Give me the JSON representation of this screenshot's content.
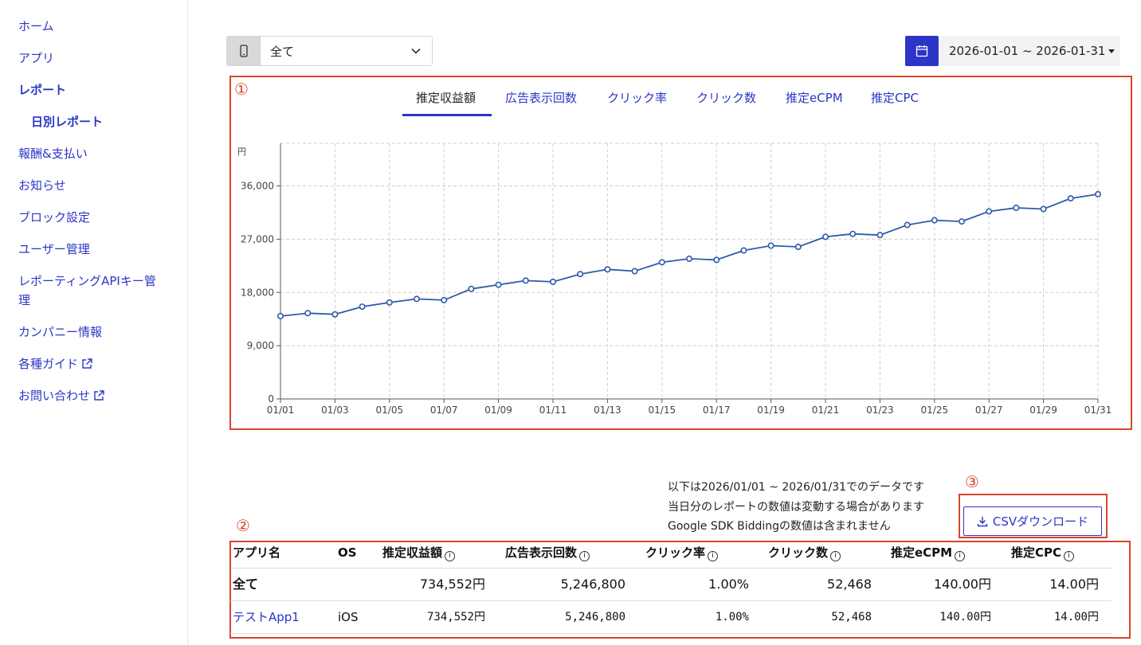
{
  "sidebar": {
    "items": [
      {
        "label": "ホーム"
      },
      {
        "label": "アプリ"
      },
      {
        "label": "レポート"
      },
      {
        "label": "日別レポート"
      },
      {
        "label": "報酬&支払い"
      },
      {
        "label": "お知らせ"
      },
      {
        "label": "ブロック設定"
      },
      {
        "label": "ユーザー管理"
      },
      {
        "label": "レポーティングAPIキー管"
      },
      {
        "label": "理"
      },
      {
        "label": "カンパニー情報"
      },
      {
        "label": "各種ガイド"
      },
      {
        "label": "お問い合わせ"
      }
    ]
  },
  "filters": {
    "app_select_value": "全て",
    "date_range": "2026-01-01 ~ 2026-01-31"
  },
  "annotations": [
    "①",
    "②",
    "③"
  ],
  "tabs": [
    {
      "label": "推定収益額",
      "active": true
    },
    {
      "label": "広告表示回数"
    },
    {
      "label": "クリック率"
    },
    {
      "label": "クリック数"
    },
    {
      "label": "推定eCPM"
    },
    {
      "label": "推定CPC"
    }
  ],
  "chart_data": {
    "type": "line",
    "ylabel": "円",
    "ylim": [
      0,
      43200
    ],
    "yticks": [
      0,
      9000,
      18000,
      27000,
      36000
    ],
    "ytick_labels": [
      "0",
      "9,000",
      "18,000",
      "27,000",
      "36,000"
    ],
    "x": [
      "01/01",
      "01/02",
      "01/03",
      "01/04",
      "01/05",
      "01/06",
      "01/07",
      "01/08",
      "01/09",
      "01/10",
      "01/11",
      "01/12",
      "01/13",
      "01/14",
      "01/15",
      "01/16",
      "01/17",
      "01/18",
      "01/19",
      "01/20",
      "01/21",
      "01/22",
      "01/23",
      "01/24",
      "01/25",
      "01/26",
      "01/27",
      "01/28",
      "01/29",
      "01/30",
      "01/31"
    ],
    "xtick_labels": [
      "01/01",
      "01/03",
      "01/05",
      "01/07",
      "01/09",
      "01/11",
      "01/13",
      "01/15",
      "01/17",
      "01/19",
      "01/21",
      "01/23",
      "01/25",
      "01/27",
      "01/29",
      "01/31"
    ],
    "series": [
      {
        "values": [
          14000,
          14500,
          14300,
          15600,
          16300,
          16900,
          16700,
          18600,
          19300,
          20000,
          19800,
          21100,
          21900,
          21600,
          23100,
          23700,
          23500,
          25100,
          25900,
          25700,
          27400,
          27900,
          27700,
          29400,
          30200,
          30000,
          31700,
          32300,
          32100,
          33900,
          34600
        ]
      }
    ],
    "grid": true,
    "line_color": "#2f5ba8"
  },
  "notes": [
    "以下は2026/01/01 ~ 2026/01/31でのデータです",
    "当日分のレポートの数値は変動する場合があります",
    "Google SDK Biddingの数値は含まれません"
  ],
  "csv_button": "CSVダウンロード",
  "table": {
    "headers": [
      "アプリ名",
      "OS",
      "推定収益額",
      "広告表示回数",
      "クリック率",
      "クリック数",
      "推定eCPM",
      "推定CPC"
    ],
    "total": {
      "name": "全て",
      "os": "",
      "revenue": "734,552円",
      "impressions": "5,246,800",
      "ctr": "1.00%",
      "clicks": "52,468",
      "ecpm": "140.00円",
      "cpc": "14.00円"
    },
    "rows": [
      {
        "name": "テストApp1",
        "os": "iOS",
        "revenue": "734,552円",
        "impressions": "5,246,800",
        "ctr": "1.00%",
        "clicks": "52,468",
        "ecpm": "140.00円",
        "cpc": "14.00円"
      }
    ]
  }
}
